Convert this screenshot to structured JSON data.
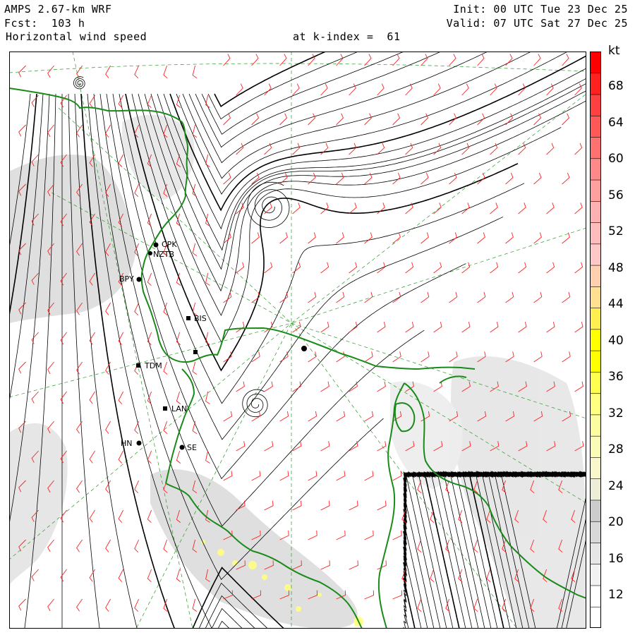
{
  "header": {
    "model": "AMPS 2.67-km WRF",
    "forecast": "Fcst:  103 h",
    "field": "Horizontal wind speed",
    "level": "at k-index =  61",
    "init": "Init: 00 UTC Tue 23 Dec 25",
    "valid": "Valid: 07 UTC Sat 27 Dec 25"
  },
  "colorbar": {
    "unit": "kt",
    "ticks": [
      "68",
      "64",
      "60",
      "56",
      "52",
      "48",
      "44",
      "40",
      "36",
      "32",
      "28",
      "24",
      "20",
      "16",
      "12"
    ],
    "colors": [
      "#ffffff",
      "#ffffff",
      "#f2f2f2",
      "#e6e6e6",
      "#d8d8d8",
      "#cccccc",
      "#eeeed8",
      "#f8f8cc",
      "#fbfbb8",
      "#fcfca0",
      "#ffff80",
      "#ffff50",
      "#ffff00",
      "#ffff00",
      "#ffee50",
      "#ffe090",
      "#ffd0b0",
      "#ffc8c8",
      "#ffbcbc",
      "#ffb0b0",
      "#ffa0a0",
      "#ff8888",
      "#ff7070",
      "#ff5858",
      "#ff4040",
      "#ff2020",
      "#ff0000"
    ]
  },
  "stations": [
    {
      "id": "CPK",
      "label": "CPK"
    },
    {
      "id": "NZTB",
      "label": "NZTB"
    },
    {
      "id": "BPY",
      "label": "BPY"
    },
    {
      "id": "BIS",
      "label": "BIS"
    },
    {
      "id": "TDM",
      "label": "TDM"
    },
    {
      "id": "LAN",
      "label": "LAN"
    },
    {
      "id": "SE",
      "label": "SE"
    },
    {
      "id": "HN",
      "label": "HN"
    }
  ],
  "colors": {
    "coastline": "#1a8a1a",
    "barb": "#ff2020",
    "streamline": "#000000",
    "gridline": "#2a9a2a"
  }
}
